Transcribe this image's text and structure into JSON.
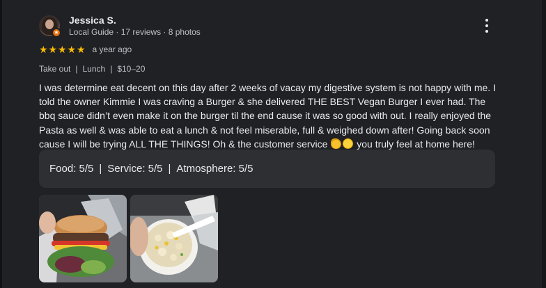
{
  "review": {
    "author_name": "Jessica S.",
    "author_meta": "Local Guide · 17 reviews · 8 photos",
    "rating": 5,
    "rating_max": 5,
    "when": "a year ago",
    "tags": [
      "Take out",
      "Lunch",
      "$10–20"
    ],
    "text_part1": "I was determine eat decent on this day after 2 weeks of vacay my digestive system is not happy with me. I told the owner Kimmie I was craving a Burger & she delivered THE BEST Vegan Burger I ever had. The bbq sauce didn’t even make it on the burger til the end cause it was so good with out. I really enjoyed the Pasta as well & was able to eat a lunch & not feel miserable, full & weighed down after! Going back soon cause I will be trying ALL THE THINGS! Oh & the customer service",
    "text_part2": "you truly feel at home here!",
    "emojis": [
      "ok-hand-emoji",
      "slightly-smiling-face-emoji"
    ],
    "subratings": [
      {
        "text": "Food: 5/5"
      },
      {
        "text": "Service: 5/5"
      },
      {
        "text": "Atmosphere: 5/5"
      }
    ],
    "photos": [
      {
        "name": "vegan-burger-photo"
      },
      {
        "name": "pasta-bowl-photo"
      }
    ]
  },
  "colors": {
    "background": "#202124",
    "star": "#fbbc04",
    "subratings_bg": "#2e2f32",
    "badge": "#e8710a"
  }
}
